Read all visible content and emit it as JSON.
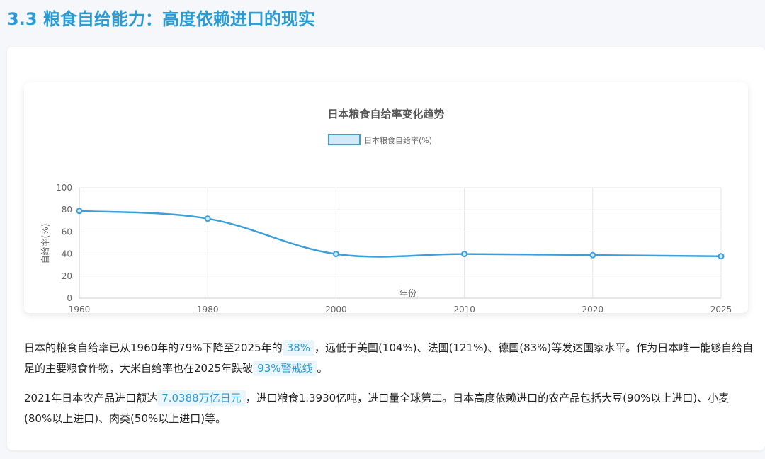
{
  "section": {
    "title": "3.3 粮食自给能力：高度依赖进口的现实"
  },
  "chart_data": {
    "type": "line",
    "title": "日本粮食自给率变化趋势",
    "xlabel": "年份",
    "ylabel": "自给率(%)",
    "x": [
      "1960",
      "1980",
      "2000",
      "2010",
      "2020",
      "2025"
    ],
    "series": [
      {
        "name": "日本粮食自给率(%)",
        "values": [
          79,
          72,
          40,
          40,
          39,
          38
        ]
      }
    ],
    "ylim": [
      0,
      100
    ],
    "yticks": [
      "0",
      "20",
      "40",
      "60",
      "80",
      "100"
    ],
    "grid": true,
    "legend_position": "top",
    "colors": {
      "line": "#3d9fd8",
      "fill": "#d3e9f8"
    }
  },
  "paragraphs": {
    "p1": {
      "t1": "日本的粮食自给率已从1960年的79%下降至2025年的",
      "h1": "38%",
      "t2": "，远低于美国(104%)、法国(121%)、德国(83%)等发达国家水平。作为日本唯一能够自给自足的主要粮食作物，大米自给率也在2025年跌破",
      "h2": "93%警戒线",
      "t3": "。"
    },
    "p2": {
      "t1": "2021年日本农产品进口额达",
      "h1": "7.0388万亿日元",
      "t2": "，进口粮食1.3930亿吨，进口量全球第二。日本高度依赖进口的农产品包括大豆(90%以上进口)、小麦(80%以上进口)、肉类(50%以上进口)等。"
    }
  }
}
